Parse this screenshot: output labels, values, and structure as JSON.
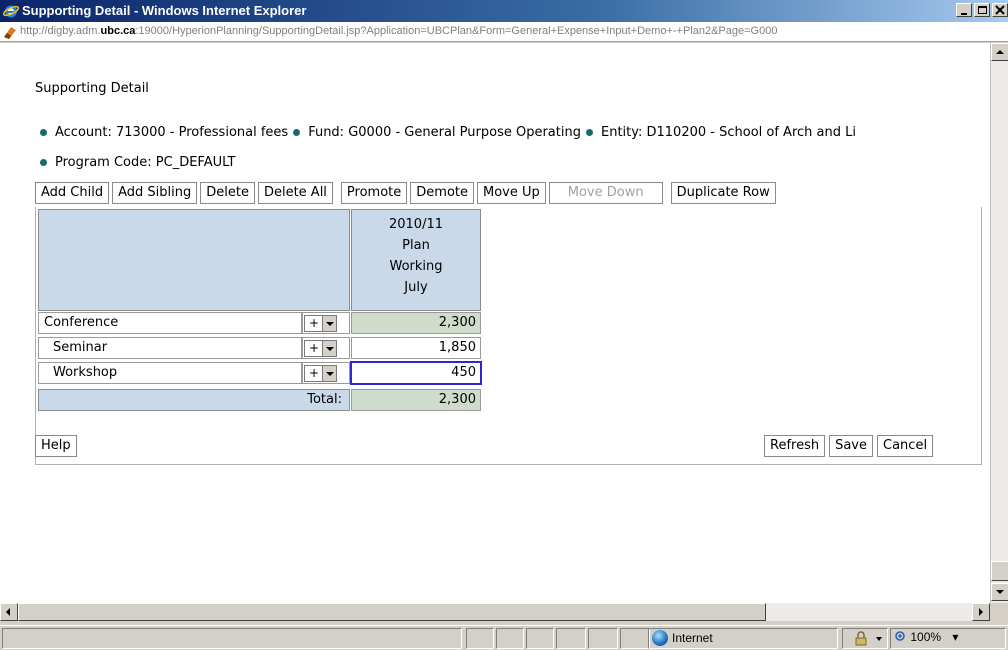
{
  "window": {
    "title": "Supporting Detail - Windows Internet Explorer",
    "url_prefix": "http://digby.adm.",
    "url_domain": "ubc.ca",
    "url_suffix": ":19000/HyperionPlanning/SupportingDetail.jsp?Application=UBCPlan&Form=General+Expense+Input+Demo+-+Plan2&Page=G000"
  },
  "page": {
    "heading": "Supporting Detail"
  },
  "dimensions": [
    "Account: 713000 - Professional fees",
    "Fund: G0000 - General Purpose Operating",
    "Entity: D110200 - School of Arch and Li",
    "Program Code: PC_DEFAULT"
  ],
  "toolbar": {
    "add_child": "Add Child",
    "add_sibling": "Add Sibling",
    "delete": "Delete",
    "delete_all": "Delete All",
    "promote": "Promote",
    "demote": "Demote",
    "move_up": "Move Up",
    "move_down": "Move Down",
    "duplicate_row": "Duplicate Row"
  },
  "grid": {
    "column_header": [
      "2010/11",
      "Plan",
      "Working",
      "July"
    ],
    "rows": [
      {
        "label": "Conference",
        "operator": "+",
        "value": "2,300"
      },
      {
        "label": "Seminar",
        "operator": "+",
        "value": "1,850"
      },
      {
        "label": "Workshop",
        "operator": "+",
        "value": "450"
      }
    ],
    "total_label": "Total:",
    "total_value": "2,300"
  },
  "footer": {
    "help": "Help",
    "refresh": "Refresh",
    "save": "Save",
    "cancel": "Cancel"
  },
  "status": {
    "zone": "Internet",
    "zoom": "100%"
  }
}
